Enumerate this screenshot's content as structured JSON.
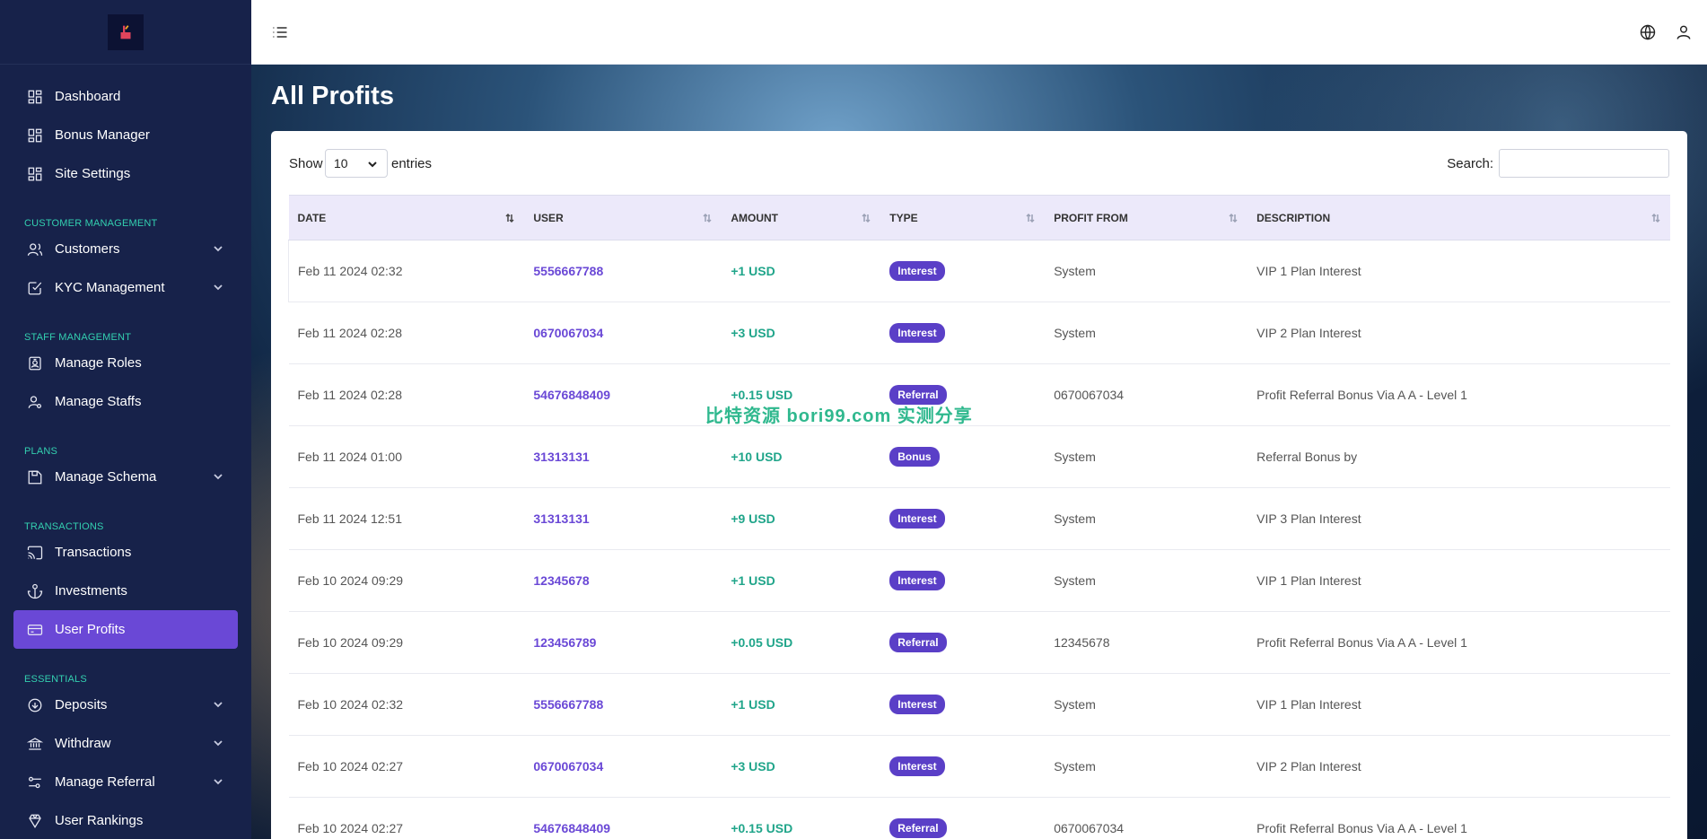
{
  "sidebar": {
    "items": [
      {
        "type": "item",
        "label": "Dashboard",
        "icon": "dashboard-icon"
      },
      {
        "type": "item",
        "label": "Bonus Manager",
        "icon": "dashboard-icon"
      },
      {
        "type": "item",
        "label": "Site Settings",
        "icon": "dashboard-icon"
      },
      {
        "type": "section",
        "label": "CUSTOMER MANAGEMENT"
      },
      {
        "type": "item",
        "label": "Customers",
        "icon": "users-icon",
        "chevron": true
      },
      {
        "type": "item",
        "label": "KYC Management",
        "icon": "checkbox-icon",
        "chevron": true
      },
      {
        "type": "section",
        "label": "STAFF MANAGEMENT"
      },
      {
        "type": "item",
        "label": "Manage Roles",
        "icon": "id-badge-icon"
      },
      {
        "type": "item",
        "label": "Manage Staffs",
        "icon": "user-cog-icon"
      },
      {
        "type": "section",
        "label": "PLANS"
      },
      {
        "type": "item",
        "label": "Manage Schema",
        "icon": "save-icon",
        "chevron": true
      },
      {
        "type": "section",
        "label": "TRANSACTIONS"
      },
      {
        "type": "item",
        "label": "Transactions",
        "icon": "cast-icon"
      },
      {
        "type": "item",
        "label": "Investments",
        "icon": "anchor-icon"
      },
      {
        "type": "item",
        "label": "User Profits",
        "icon": "credit-card-icon",
        "active": true
      },
      {
        "type": "section",
        "label": "ESSENTIALS"
      },
      {
        "type": "item",
        "label": "Deposits",
        "icon": "arrow-down-circle-icon",
        "chevron": true
      },
      {
        "type": "item",
        "label": "Withdraw",
        "icon": "bank-icon",
        "chevron": true
      },
      {
        "type": "item",
        "label": "Manage Referral",
        "icon": "sliders-icon",
        "chevron": true
      },
      {
        "type": "item",
        "label": "User Rankings",
        "icon": "award-icon"
      }
    ]
  },
  "page": {
    "title": "All Profits"
  },
  "controls": {
    "show_label": "Show",
    "entries_value": "10",
    "entries_label": "entries",
    "search_label": "Search:",
    "search_value": ""
  },
  "table": {
    "columns": [
      "DATE",
      "USER",
      "AMOUNT",
      "TYPE",
      "PROFIT FROM",
      "DESCRIPTION"
    ],
    "rows": [
      {
        "date": "Feb 11 2024 02:32",
        "user": "5556667788",
        "amount": "+1 USD",
        "type": "Interest",
        "from": "System",
        "desc": "VIP 1 Plan Interest"
      },
      {
        "date": "Feb 11 2024 02:28",
        "user": "0670067034",
        "amount": "+3 USD",
        "type": "Interest",
        "from": "System",
        "desc": "VIP 2 Plan Interest"
      },
      {
        "date": "Feb 11 2024 02:28",
        "user": "54676848409",
        "amount": "+0.15 USD",
        "type": "Referral",
        "from": "0670067034",
        "desc": "Profit Referral Bonus Via A A - Level 1"
      },
      {
        "date": "Feb 11 2024 01:00",
        "user": "31313131",
        "amount": "+10 USD",
        "type": "Bonus",
        "from": "System",
        "desc": "Referral Bonus by"
      },
      {
        "date": "Feb 11 2024 12:51",
        "user": "31313131",
        "amount": "+9 USD",
        "type": "Interest",
        "from": "System",
        "desc": "VIP 3 Plan Interest"
      },
      {
        "date": "Feb 10 2024 09:29",
        "user": "12345678",
        "amount": "+1 USD",
        "type": "Interest",
        "from": "System",
        "desc": "VIP 1 Plan Interest"
      },
      {
        "date": "Feb 10 2024 09:29",
        "user": "123456789",
        "amount": "+0.05 USD",
        "type": "Referral",
        "from": "12345678",
        "desc": "Profit Referral Bonus Via A A - Level 1"
      },
      {
        "date": "Feb 10 2024 02:32",
        "user": "5556667788",
        "amount": "+1 USD",
        "type": "Interest",
        "from": "System",
        "desc": "VIP 1 Plan Interest"
      },
      {
        "date": "Feb 10 2024 02:27",
        "user": "0670067034",
        "amount": "+3 USD",
        "type": "Interest",
        "from": "System",
        "desc": "VIP 2 Plan Interest"
      },
      {
        "date": "Feb 10 2024 02:27",
        "user": "54676848409",
        "amount": "+0.15 USD",
        "type": "Referral",
        "from": "0670067034",
        "desc": "Profit Referral Bonus Via A A - Level 1"
      }
    ]
  },
  "watermark": "比特资源 bori99.com 实测分享",
  "colors": {
    "sidebar_bg": "#17224a",
    "accent": "#6a48d6",
    "section_label": "#33d0b0",
    "amount_green": "#20a58a",
    "badge_bg": "#5a3fc7"
  }
}
